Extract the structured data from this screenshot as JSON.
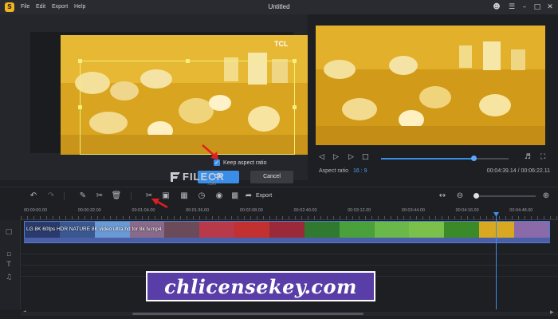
{
  "app": {
    "title": "Untitled",
    "logo_glyph": "S",
    "menu": [
      "File",
      "Edit",
      "Export",
      "Help"
    ]
  },
  "window_controls": [
    "user-icon",
    "menu-icon",
    "minimize-icon",
    "maximize-icon",
    "close-icon"
  ],
  "crop_dialog": {
    "brand_overlay": "TCL",
    "keep_aspect_label": "Keep aspect ratio",
    "keep_aspect_checked": true,
    "ok_label": "OK",
    "cancel_label": "Cancel"
  },
  "preview": {
    "aspect_label": "Aspect ratio",
    "aspect_value": "16 : 9",
    "time_current": "00:04:39.14",
    "time_total": "00:06:22.11",
    "progress": 0.73
  },
  "watermark": {
    "text": "FILECR",
    "sub": ".com"
  },
  "toolbar": {
    "export_label": "Export",
    "tools": [
      "undo-icon",
      "redo-icon",
      "pen-icon",
      "scissors-icon",
      "delete-icon",
      "crop-icon",
      "fit-icon",
      "split-icon",
      "duration-icon",
      "freeze-icon",
      "mosaic-icon",
      "export-icon"
    ],
    "zoom_level": 0.05
  },
  "timeline": {
    "ruler_labels": [
      "00:00:00.00",
      "00:00:32.00",
      "00:01:04.00",
      "00:01:36.00",
      "00:02:08.00",
      "00:02:40.00",
      "00:03:12.00",
      "00:03:44.00",
      "00:04:16.00",
      "00:04:48.00"
    ],
    "clip_name": "LG 8K 60fps HDR NATURE 8K video ultra hd for 8k tv.mp4",
    "playhead_time": "00:04:39.14"
  },
  "overlay_banner": {
    "text": "chlicensekey.com"
  },
  "colors": {
    "accent": "#3a8ee8",
    "crop_outline": "#f2ee78",
    "banner_bg": "#5a3ea8"
  }
}
